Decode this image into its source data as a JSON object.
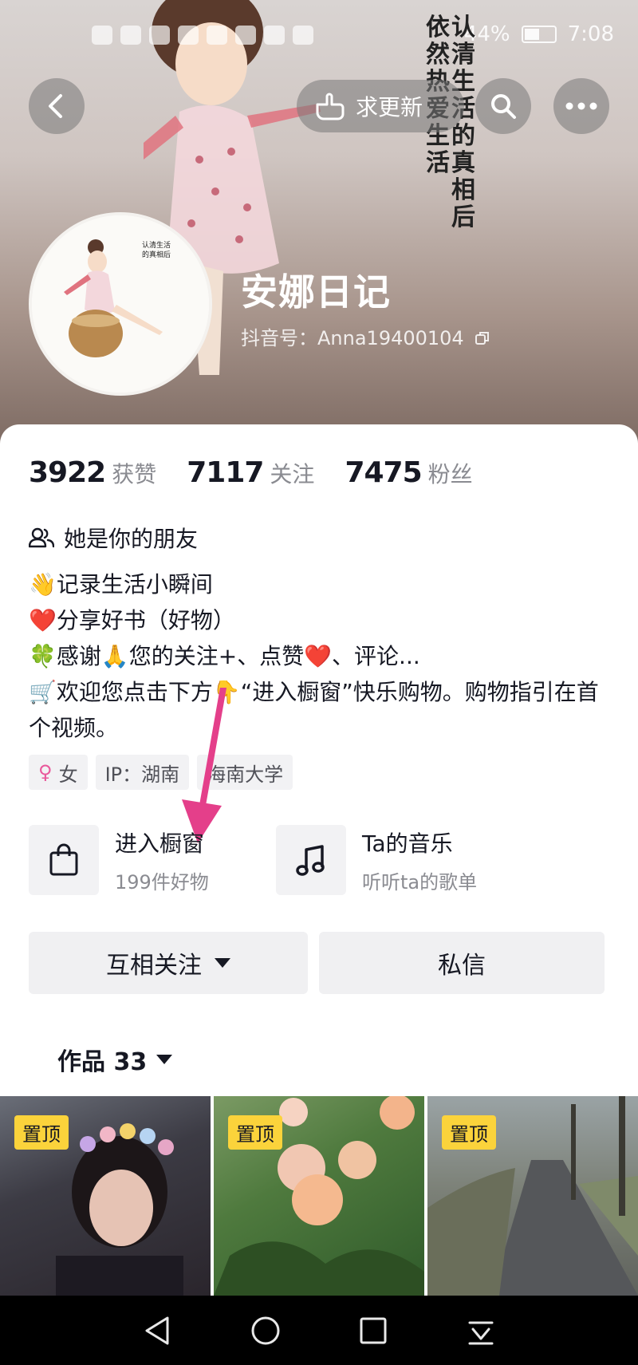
{
  "status_bar": {
    "battery_percent": "44%",
    "time": "7:08"
  },
  "header": {
    "request_update_label": "求更新",
    "banner_text_line1": "认清生活的真相后",
    "banner_text_line2": "依然热爱生活"
  },
  "profile": {
    "name": "安娜日记",
    "douyin_id_label": "抖音号：",
    "douyin_id": "Anna19400104"
  },
  "stats": [
    {
      "value": "3922",
      "label": "获赞"
    },
    {
      "value": "7117",
      "label": "关注"
    },
    {
      "value": "7475",
      "label": "粉丝"
    }
  ],
  "relationship": "她是你的朋友",
  "bio": [
    "👋记录生活小瞬间",
    "❤️分享好书（好物）",
    "🍀感谢🙏您的关注+、点赞❤️、评论...",
    "🛒欢迎您点击下方👇“进入橱窗”快乐购物。购物指引在首个视频。"
  ],
  "tags": {
    "gender": "女",
    "ip": "IP：湖南",
    "school": "海南大学"
  },
  "entries": {
    "shop": {
      "title": "进入橱窗",
      "subtitle": "199件好物"
    },
    "music": {
      "title": "Ta的音乐",
      "subtitle": "听听ta的歌单"
    }
  },
  "actions": {
    "follow_label": "互相关注",
    "message_label": "私信"
  },
  "works": {
    "tab_label": "作品 33"
  },
  "videos": [
    {
      "badge": "置顶"
    },
    {
      "badge": "置顶"
    },
    {
      "badge": "置顶"
    }
  ],
  "colors": {
    "pin_badge": "#fbd33b",
    "arrow": "#e43f8a",
    "female_icon": "#e9589b"
  }
}
